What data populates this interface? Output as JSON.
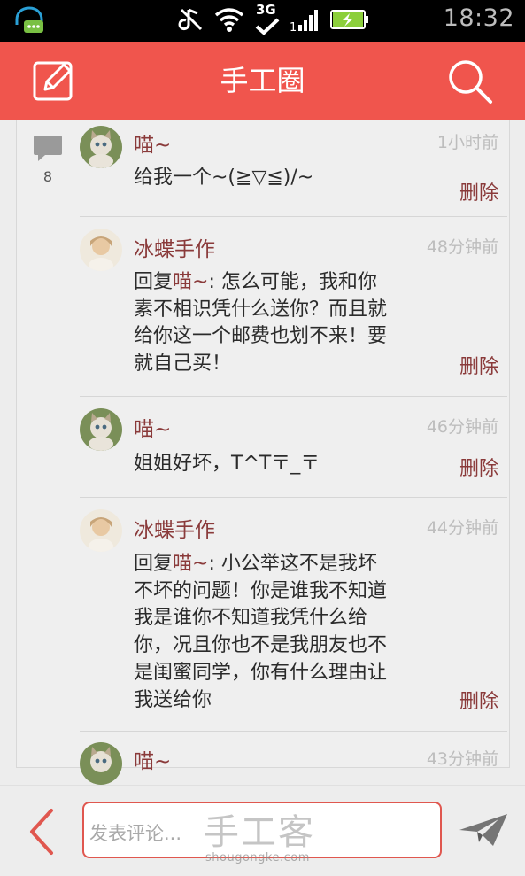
{
  "status_bar": {
    "time": "18:32",
    "network": "3G",
    "icons": [
      "notification-chat-icon",
      "mute-icon",
      "wifi-icon",
      "3g-icon",
      "signal-icon",
      "battery-icon"
    ]
  },
  "app_bar": {
    "title": "手工圈",
    "left_icon": "edit-icon",
    "right_icon": "search-icon",
    "color": "#f0554d"
  },
  "comment_count": "8",
  "comments": [
    {
      "author": "喵~",
      "time": "1小时前",
      "reply_prefix": "",
      "reply_to": "",
      "text": "给我一个~(≧▽≦)/~",
      "delete_label": "删除"
    },
    {
      "author": "冰蝶手作",
      "time": "48分钟前",
      "reply_prefix": "回复",
      "reply_to": "喵~",
      "text": ": 怎么可能，我和你素不相识凭什么送你？而且就给你这一个邮费也划不来！要就自己买！",
      "delete_label": "删除"
    },
    {
      "author": "喵~",
      "time": "46分钟前",
      "reply_prefix": "",
      "reply_to": "",
      "text": "姐姐好坏，T^T〒_〒",
      "delete_label": "删除"
    },
    {
      "author": "冰蝶手作",
      "time": "44分钟前",
      "reply_prefix": "回复",
      "reply_to": "喵~",
      "text": ": 小公举这不是我坏不坏的问题！你是谁我不知道我是谁你不知道我凭什么给你，况且你也不是我朋友也不是闺蜜同学，你有什么理由让我送给你",
      "delete_label": "删除"
    },
    {
      "author": "喵~",
      "time": "43分钟前",
      "reply_prefix": "",
      "reply_to": "",
      "text": "",
      "delete_label": ""
    }
  ],
  "bottom_bar": {
    "placeholder": "发表评论...",
    "watermark": "手工客",
    "watermark_url": "shougongke.com"
  }
}
